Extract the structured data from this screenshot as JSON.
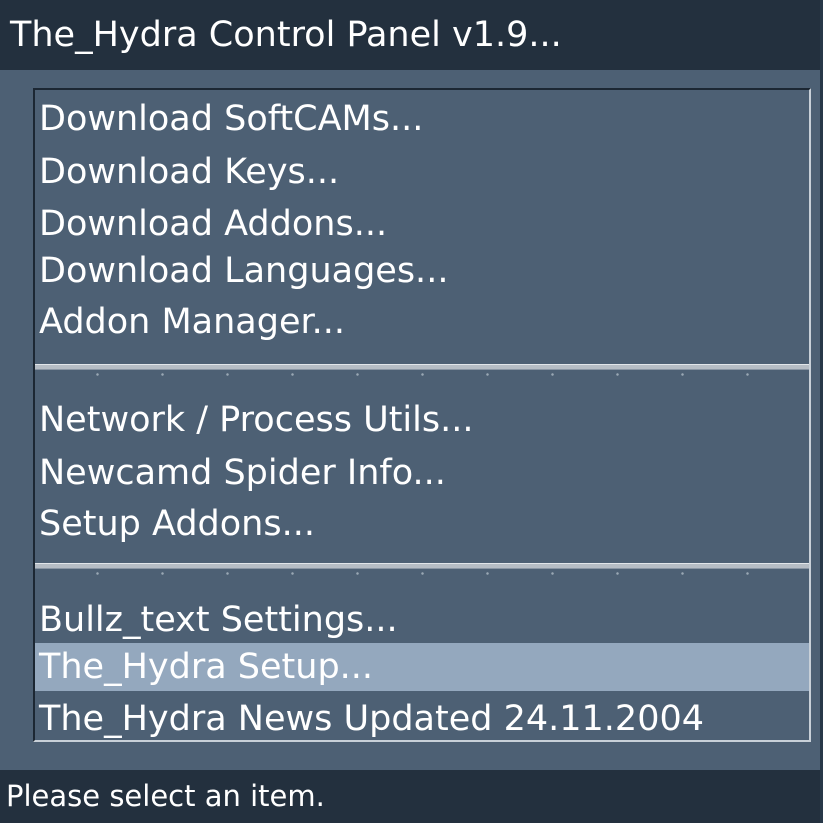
{
  "window": {
    "title": "The_Hydra Control Panel v1.9..."
  },
  "menu": {
    "items": [
      {
        "label": "Download SoftCAMs...",
        "selected": false
      },
      {
        "label": "Download Keys...",
        "selected": false
      },
      {
        "label": "Download Addons...",
        "selected": false
      },
      {
        "label": "Download Languages...",
        "selected": false
      },
      {
        "label": "Addon Manager...",
        "selected": false
      },
      {
        "label": "Network / Process Utils...",
        "selected": false
      },
      {
        "label": "Newcamd Spider Info...",
        "selected": false
      },
      {
        "label": "Setup Addons...",
        "selected": false
      },
      {
        "label": "Bullz_text Settings...",
        "selected": false
      },
      {
        "label": "The_Hydra Setup...",
        "selected": true
      },
      {
        "label": "The_Hydra News Updated 24.11.2004",
        "selected": false
      }
    ]
  },
  "status": {
    "text": "Please select an item."
  },
  "colors": {
    "background": "#4d6074",
    "titlebar": "#23303e",
    "selection": "#94a8be",
    "text": "#ffffff"
  }
}
